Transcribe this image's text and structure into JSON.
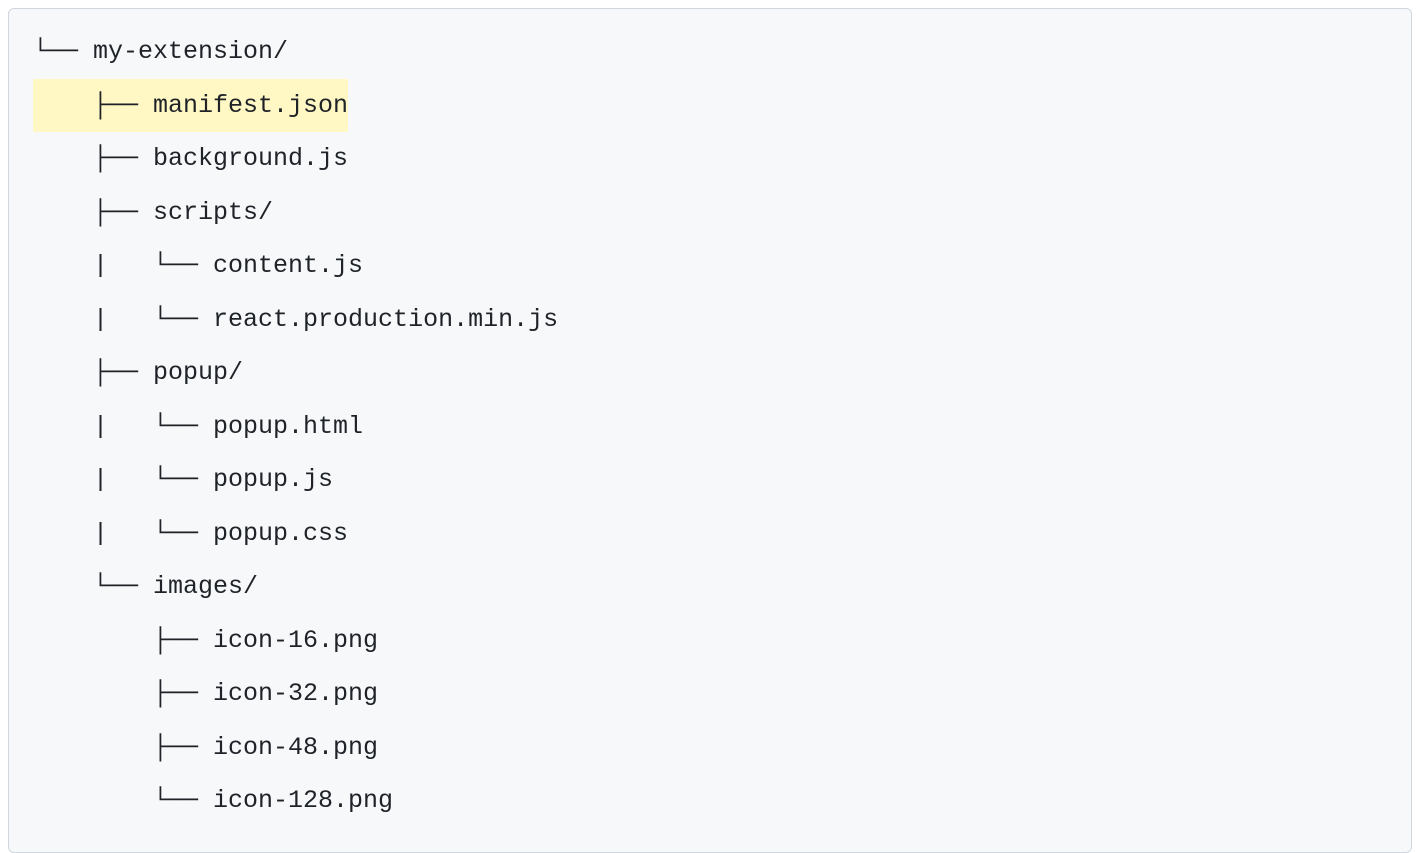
{
  "tree": {
    "lines": [
      {
        "prefix": "└── ",
        "text": "my-extension/",
        "highlighted": false
      },
      {
        "prefix": "    ├── ",
        "text": "manifest.json",
        "highlighted": true
      },
      {
        "prefix": "    ├── ",
        "text": "background.js",
        "highlighted": false
      },
      {
        "prefix": "    ├── ",
        "text": "scripts/",
        "highlighted": false
      },
      {
        "prefix": "    |   └── ",
        "text": "content.js",
        "highlighted": false
      },
      {
        "prefix": "    |   └── ",
        "text": "react.production.min.js",
        "highlighted": false
      },
      {
        "prefix": "    ├── ",
        "text": "popup/",
        "highlighted": false
      },
      {
        "prefix": "    |   └── ",
        "text": "popup.html",
        "highlighted": false
      },
      {
        "prefix": "    |   └── ",
        "text": "popup.js",
        "highlighted": false
      },
      {
        "prefix": "    |   └── ",
        "text": "popup.css",
        "highlighted": false
      },
      {
        "prefix": "    └── ",
        "text": "images/",
        "highlighted": false
      },
      {
        "prefix": "        ├── ",
        "text": "icon-16.png",
        "highlighted": false
      },
      {
        "prefix": "        ├── ",
        "text": "icon-32.png",
        "highlighted": false
      },
      {
        "prefix": "        ├── ",
        "text": "icon-48.png",
        "highlighted": false
      },
      {
        "prefix": "        └── ",
        "text": "icon-128.png",
        "highlighted": false
      }
    ]
  }
}
